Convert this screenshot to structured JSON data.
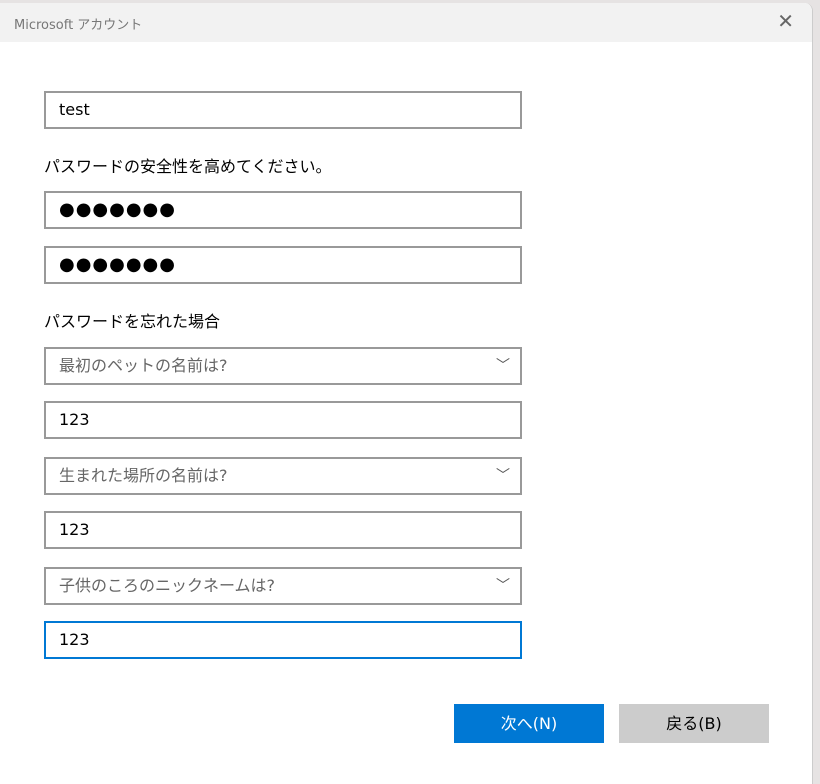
{
  "window": {
    "title": "Microsoft アカウント",
    "close": "✕"
  },
  "form": {
    "username": "test",
    "password_label": "パスワードの安全性を高めてください。",
    "password": "●●●●●●●",
    "password_confirm": "●●●●●●●",
    "forgot_label": "パスワードを忘れた場合",
    "questions": [
      {
        "question": "最初のペットの名前は?",
        "answer": "123"
      },
      {
        "question": "生まれた場所の名前は?",
        "answer": "123"
      },
      {
        "question": "子供のころのニックネームは?",
        "answer": "123"
      }
    ]
  },
  "buttons": {
    "next": "次へ(N)",
    "back": "戻る(B)"
  },
  "colors": {
    "accent": "#0078d4"
  }
}
